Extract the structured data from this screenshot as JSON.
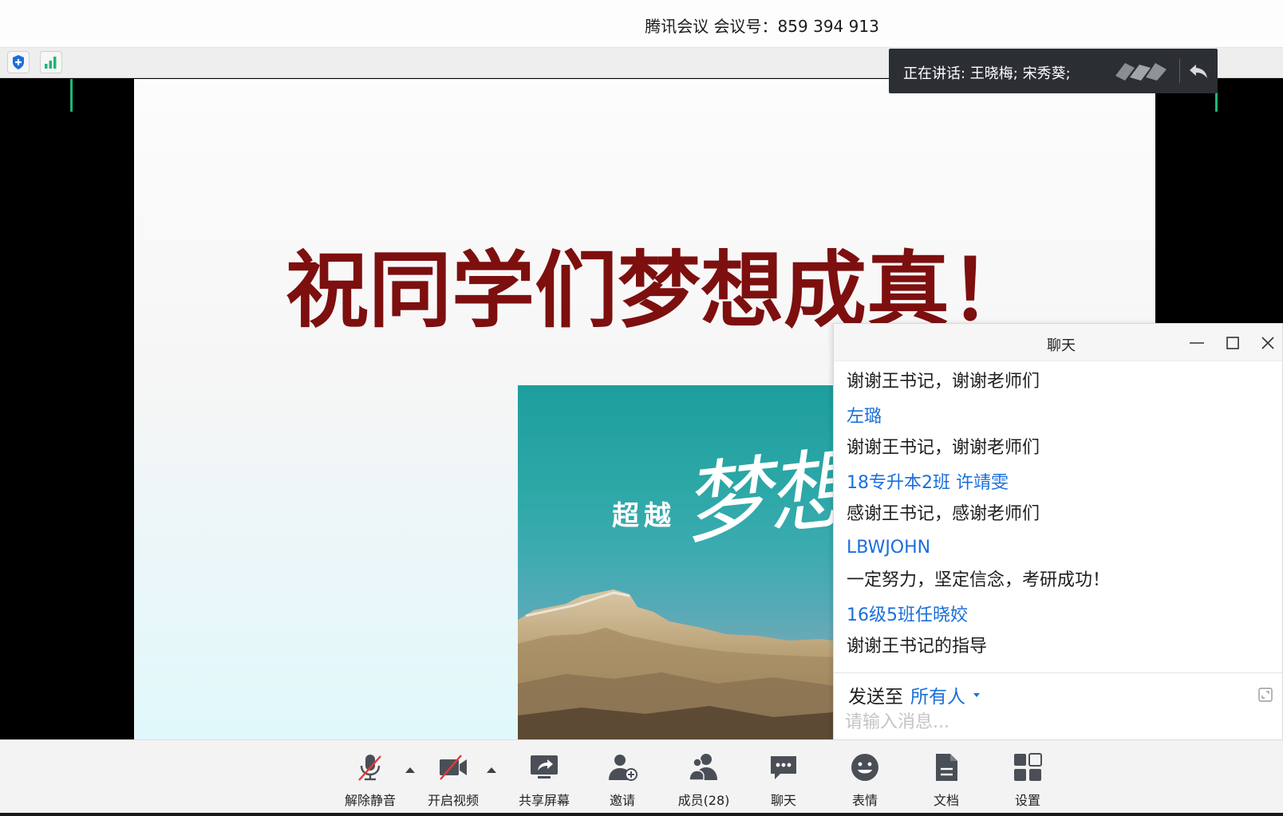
{
  "window": {
    "title": "腾讯会议 会议号：859 394 913"
  },
  "infobar": {
    "icons": [
      "shield-icon",
      "signal-strength-icon"
    ]
  },
  "speaking": {
    "text": "正在讲话: 王晓梅; 宋秀葵;"
  },
  "slide": {
    "title": "祝同学们梦想成真！",
    "image_text_small": "超越",
    "image_text_large": "梦想"
  },
  "chat": {
    "title": "聊天",
    "messages": [
      {
        "type": "text",
        "text": "谢谢王书记，谢谢老师们"
      },
      {
        "type": "sender",
        "text": "左璐"
      },
      {
        "type": "text",
        "text": "谢谢王书记，谢谢老师们"
      },
      {
        "type": "sender",
        "text": "18专升本2班 许靖雯"
      },
      {
        "type": "text",
        "text": "感谢王书记，感谢老师们"
      },
      {
        "type": "sender",
        "text": "LBWJOHN"
      },
      {
        "type": "text",
        "text": "一定努力，坚定信念，考研成功！"
      },
      {
        "type": "sender",
        "text": "16级5班任晓姣"
      },
      {
        "type": "text",
        "text": "谢谢王书记的指导"
      }
    ],
    "send_to_label": "发送至",
    "recipient": "所有人",
    "input_placeholder": "请输入消息..."
  },
  "toolbar": {
    "unmute_label": "解除静音",
    "start_video_label": "开启视频",
    "share_screen_label": "共享屏幕",
    "invite_label": "邀请",
    "members_label": "成员(28)",
    "chat_label": "聊天",
    "reactions_label": "表情",
    "documents_label": "文档",
    "settings_label": "设置"
  },
  "colors": {
    "accent_blue": "#1b6fd9",
    "speaker_green": "#22b573",
    "slide_title_red": "#7d0f0f",
    "mute_red": "#e53935"
  }
}
